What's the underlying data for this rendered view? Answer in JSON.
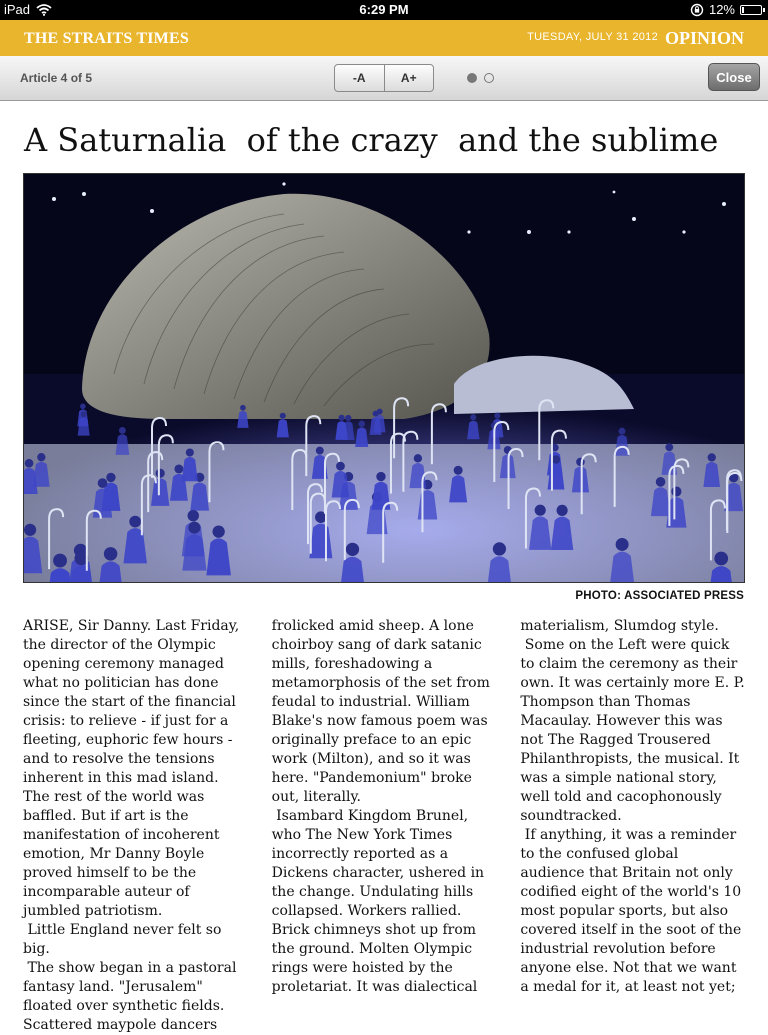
{
  "status_bar": {
    "device": "iPad",
    "time": "6:29 PM",
    "battery_percent": "12%",
    "battery_level": 0.12
  },
  "masthead": {
    "logo": "THE STRAITS TIMES",
    "date": "TUESDAY, JULY 31 2012",
    "section": "OPINION"
  },
  "toolbar": {
    "article_count": "Article 4 of 5",
    "font_decrease": "-A",
    "font_increase": "A+",
    "page_dots": {
      "total": 2,
      "current": 1
    },
    "close_label": "Close"
  },
  "article": {
    "headline": "A Saturnalia  of the crazy  and the sublime",
    "photo_credit": "PHOTO: ASSOCIATED PRESS",
    "columns": [
      [
        "ARISE, Sir Danny. Last Friday, the director of the Olympic opening ceremony managed what no politician has done since the start of the financial crisis: to relieve - if just for a fleeting, euphoric few hours - and to resolve the tensions inherent in this mad island. The rest of the world was baffled. But if art is the manifestation of incoherent emotion, Mr Danny Boyle proved himself to be the incomparable auteur of jumbled patriotism.",
        " Little England never felt so big.",
        " The show began in a pastoral fantasy land. \"Jerusalem\" floated over synthetic fields. Scattered maypole dancers"
      ],
      [
        "frolicked amid sheep. A lone choirboy sang of dark satanic mills, foreshadowing a metamorphosis of the set from feudal to industrial. William Blake's now famous poem was originally preface to an epic work (Milton), and so it was here. \"Pandemonium\" broke out, literally.",
        " Isambard Kingdom Brunel, who The New York Times incorrectly reported as a Dickens character, ushered in the change. Undulating hills collapsed. Workers rallied. Brick chimneys shot up from the ground. Molten Olympic rings were hoisted by the proletariat. It was dialectical"
      ],
      [
        "materialism, Slumdog style.",
        " Some on the Left were quick to claim the ceremony as their own. It was certainly more E. P. Thompson than Thomas Macaulay. However this was not The Ragged Trousered Philanthropists, the musical. It was a simple national story, well told and cacophonously soundtracked.",
        " If anything, it was a reminder to the confused global audience that Britain not only codified eight of the world's 10 most popular sports, but also covered itself in the soot of the industrial revolution before anyone else. Not that we want a medal for it, at least not yet;"
      ]
    ]
  }
}
